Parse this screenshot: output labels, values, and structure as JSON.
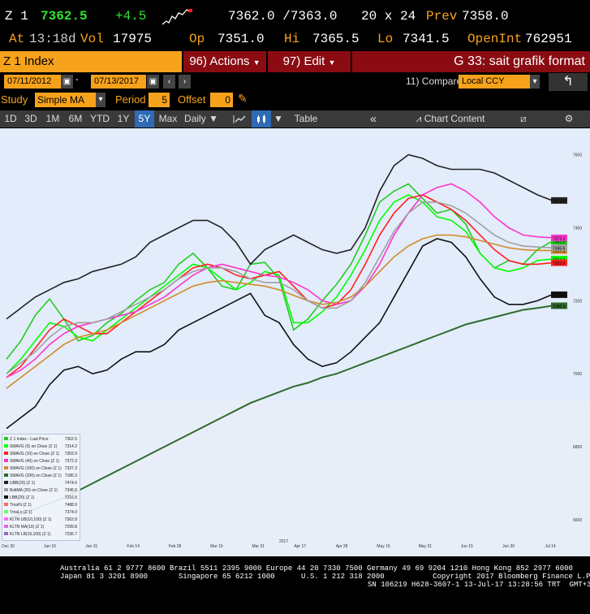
{
  "quote": {
    "ticker": "Z 1",
    "last": "7362.5",
    "change": "+4.5",
    "bid_ask": "7362.0 /7363.0",
    "size": "20 x 24",
    "prev_label": "Prev",
    "prev": "7358.0",
    "at_label": "At",
    "time": "13:18d",
    "vol_label": "Vol",
    "vol": "17975",
    "op_label": "Op",
    "op": "7351.0",
    "hi_label": "Hi",
    "hi": "7365.5",
    "lo_label": "Lo",
    "lo": "7341.5",
    "oi_label": "OpenInt",
    "oi": "762951"
  },
  "titlebar": {
    "security": "Z 1 Index",
    "actions": "96) Actions",
    "edit": "97) Edit",
    "page_title": "G 33: sait grafik format"
  },
  "range": {
    "start": "07/11/2012",
    "end": "07/13/2017",
    "compare_label": "11) Compare",
    "compare_value": "Local CCY"
  },
  "study": {
    "label": "Study",
    "value": "Simple MA",
    "period_label": "Period",
    "period": "5",
    "offset_label": "Offset",
    "offset": "0"
  },
  "toolbar": {
    "periods": [
      "1D",
      "3D",
      "1M",
      "6M",
      "YTD",
      "1Y",
      "5Y",
      "Max"
    ],
    "selected": "5Y",
    "frequency": "Daily",
    "table": "Table",
    "chart_content": "Chart Content"
  },
  "colors": {
    "amber": "#f7a21b",
    "bloomberg_red": "#8a0c12",
    "selected_blue": "#2f6bb5",
    "chart_bg": "#e6eefb"
  },
  "chart_data": {
    "type": "line",
    "title": "",
    "x_ticks": [
      "Dec 30",
      "Jan 16",
      "Jan 31",
      "Feb 14",
      "Feb 28",
      "Mar 15",
      "Mar 31",
      "Apr 17",
      "Apr 28",
      "May 15",
      "May 31",
      "Jun 15",
      "Jun 30",
      "Jul 14"
    ],
    "year_label": "2017",
    "y_ticks": [
      6600,
      6800,
      7000,
      7200,
      7400,
      7600
    ],
    "ylim": [
      6560,
      7650
    ],
    "grid": false,
    "legend_position": "bottom-left",
    "series": [
      {
        "name": "Z 1 Index - Last Price",
        "last": "7362.5",
        "color": "#22cc22",
        "values": [
          7040,
          7090,
          7160,
          7205,
          7150,
          7090,
          7105,
          7140,
          7165,
          7200,
          7230,
          7250,
          7300,
          7330,
          7290,
          7240,
          7230,
          7300,
          7305,
          7260,
          7120,
          7150,
          7200,
          7245,
          7300,
          7380,
          7470,
          7500,
          7520,
          7480,
          7440,
          7450,
          7410,
          7330,
          7290,
          7310,
          7300,
          7340,
          7362.5
        ]
      },
      {
        "name": "SMAVG (5) on Close (Z 1)",
        "last": "7314.2",
        "color": "#00ff00",
        "values": [
          7000,
          7040,
          7090,
          7140,
          7130,
          7100,
          7090,
          7120,
          7150,
          7180,
          7210,
          7240,
          7270,
          7300,
          7290,
          7260,
          7230,
          7250,
          7280,
          7270,
          7140,
          7140,
          7170,
          7210,
          7270,
          7340,
          7420,
          7470,
          7490,
          7470,
          7430,
          7420,
          7390,
          7330,
          7290,
          7280,
          7290,
          7310,
          7314.2
        ]
      },
      {
        "name": "SMAVG (10) on Close (Z 1)",
        "last": "7303.9",
        "color": "#ff2020",
        "values": [
          6990,
          7020,
          7070,
          7120,
          7150,
          7130,
          7110,
          7110,
          7140,
          7170,
          7200,
          7230,
          7260,
          7290,
          7300,
          7290,
          7270,
          7260,
          7270,
          7280,
          7240,
          7200,
          7180,
          7190,
          7230,
          7300,
          7380,
          7440,
          7480,
          7490,
          7470,
          7450,
          7420,
          7380,
          7340,
          7310,
          7300,
          7300,
          7303.9
        ]
      },
      {
        "name": "SMAVG (40) on Close (Z 1)",
        "last": "7372.3",
        "color": "#ff33cc",
        "values": [
          6990,
          7010,
          7040,
          7080,
          7110,
          7130,
          7140,
          7150,
          7160,
          7170,
          7190,
          7210,
          7240,
          7270,
          7290,
          7300,
          7290,
          7280,
          7270,
          7265,
          7250,
          7230,
          7200,
          7190,
          7200,
          7240,
          7300,
          7380,
          7440,
          7490,
          7510,
          7520,
          7500,
          7470,
          7430,
          7400,
          7380,
          7375,
          7372.3
        ]
      },
      {
        "name": "SMAVG (100) on Close (Z 1)",
        "last": "7337.3",
        "color": "#d28a2a",
        "values": [
          6960,
          6990,
          7020,
          7050,
          7080,
          7100,
          7110,
          7120,
          7140,
          7160,
          7180,
          7200,
          7220,
          7240,
          7250,
          7255,
          7250,
          7245,
          7240,
          7230,
          7215,
          7200,
          7190,
          7195,
          7210,
          7240,
          7280,
          7320,
          7350,
          7370,
          7380,
          7380,
          7375,
          7365,
          7355,
          7345,
          7340,
          7338,
          7337.3
        ]
      },
      {
        "name": "SMAVG (200) on Close (Z 1)",
        "last": "7186.3",
        "color": "#2e6b2e",
        "values": [
          6600,
          6615,
          6630,
          6645,
          6660,
          6680,
          6700,
          6720,
          6740,
          6760,
          6780,
          6800,
          6820,
          6840,
          6860,
          6880,
          6900,
          6920,
          6935,
          6950,
          6965,
          6975,
          6990,
          7000,
          7015,
          7030,
          7045,
          7060,
          7075,
          7090,
          7105,
          7120,
          7135,
          7145,
          7155,
          7165,
          7175,
          7180,
          7186.3
        ]
      },
      {
        "name": "UBB(20) (Z 1)",
        "last": "7474.6",
        "color": "#222222",
        "values": [
          7150,
          7180,
          7210,
          7230,
          7250,
          7260,
          7280,
          7290,
          7300,
          7320,
          7360,
          7380,
          7400,
          7420,
          7420,
          7400,
          7360,
          7300,
          7340,
          7360,
          7380,
          7360,
          7340,
          7330,
          7340,
          7400,
          7500,
          7570,
          7600,
          7590,
          7570,
          7560,
          7560,
          7560,
          7550,
          7530,
          7510,
          7490,
          7474.6
        ]
      },
      {
        "name": "BollMA (20) on Close (Z 1)",
        "last": "7345.5",
        "color": "#a0a0a0",
        "values": [
          7000,
          7030,
          7060,
          7100,
          7130,
          7140,
          7140,
          7150,
          7170,
          7190,
          7210,
          7230,
          7260,
          7280,
          7290,
          7290,
          7280,
          7260,
          7250,
          7250,
          7230,
          7200,
          7180,
          7180,
          7200,
          7250,
          7320,
          7390,
          7440,
          7470,
          7470,
          7460,
          7440,
          7410,
          7380,
          7360,
          7350,
          7347,
          7345.5
        ]
      },
      {
        "name": "LBB(20) (Z 1)",
        "last": "7216.5",
        "color": "#111111",
        "values": [
          6850,
          6880,
          6910,
          6970,
          7010,
          7020,
          7000,
          7010,
          7040,
          7060,
          7060,
          7080,
          7120,
          7140,
          7160,
          7180,
          7200,
          7220,
          7160,
          7140,
          7080,
          7040,
          7020,
          7030,
          7060,
          7100,
          7140,
          7210,
          7280,
          7350,
          7370,
          7360,
          7320,
          7260,
          7210,
          7190,
          7190,
          7200,
          7216.5
        ]
      },
      {
        "name": "TmaHi (Z 1)",
        "last": "7488.9",
        "color": "#ff6666",
        "values": []
      },
      {
        "name": "TmaLo (Z 1)",
        "last": "7374.0",
        "color": "#66ff66",
        "values": []
      },
      {
        "name": "KLTN UB(10,100) (Z 1)",
        "last": "7362.8",
        "color": "#ff66ff",
        "values": []
      },
      {
        "name": "KLTN MA(10) (Z 1)",
        "last": "7299.8",
        "color": "#e066e0",
        "values": []
      },
      {
        "name": "KLTN LB(10,100) (Z 1)",
        "last": "7236.7",
        "color": "#9966cc",
        "values": []
      }
    ]
  },
  "footer": {
    "line1": "Australia 61 2 9777 8600 Brazil 5511 2395 9000 Europe 44 20 7330 7500 Germany 49 69 9204 1210 Hong Kong 852 2977 6000",
    "line2": "Japan 81 3 3201 8900       Singapore 65 6212 1000      U.S. 1 212 318 2000           Copyright 2017 Bloomberg Finance L.P.",
    "line3": "SN 106219 H628-3607-1 13-Jul-17 13:28:56 TRT  GMT+3:00"
  }
}
